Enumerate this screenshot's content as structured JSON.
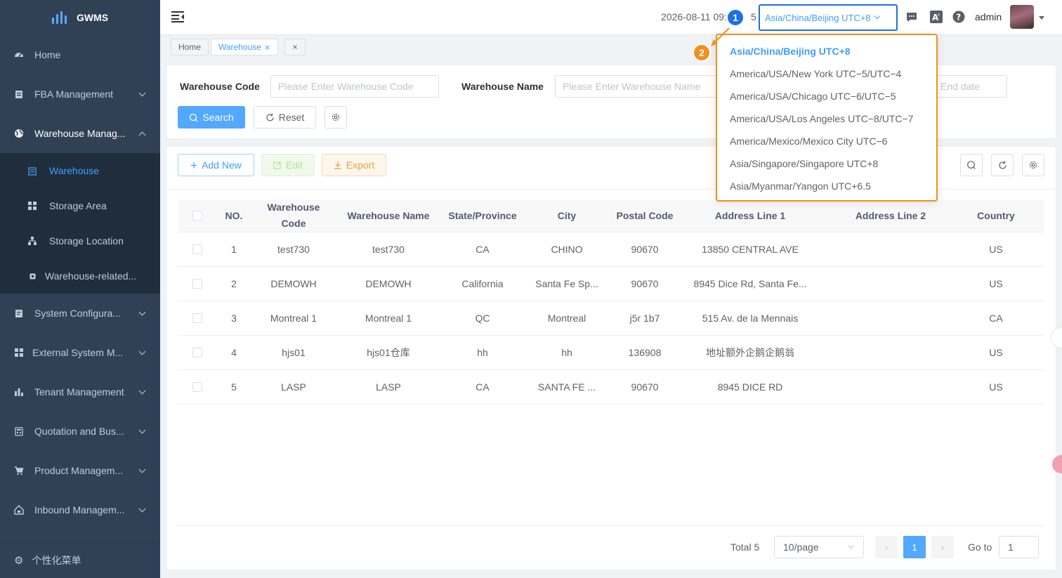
{
  "app": {
    "logo_text": "GWMS"
  },
  "sidebar": {
    "items": [
      {
        "label": "Home",
        "icon": "dashboard-icon"
      },
      {
        "label": "FBA Management",
        "icon": "clipboard-icon"
      },
      {
        "label": "Warehouse Manag...",
        "icon": "globe-icon"
      }
    ],
    "sub_items": [
      {
        "label": "Warehouse",
        "icon": "warehouse-icon",
        "active": true
      },
      {
        "label": "Storage Area",
        "icon": "grid-icon"
      },
      {
        "label": "Storage Location",
        "icon": "tree-icon"
      },
      {
        "label": "Warehouse-related...",
        "icon": "small-box-icon"
      }
    ],
    "items_after": [
      {
        "label": "System Configura...",
        "icon": "document-icon"
      },
      {
        "label": "External System M...",
        "icon": "apps-icon"
      },
      {
        "label": "Tenant Management",
        "icon": "bar-chart-icon"
      },
      {
        "label": "Quotation and Bus...",
        "icon": "calculator-icon"
      },
      {
        "label": "Product Managem...",
        "icon": "cart-icon"
      },
      {
        "label": "Inbound Managem...",
        "icon": "home-box-icon"
      }
    ],
    "bottom_label": "个性化菜单"
  },
  "header": {
    "datetime": "2026-08-11 09:",
    "datetime_tail": "5",
    "timezone": "Asia/China/Beijing UTC+8",
    "username": "admin"
  },
  "tags": {
    "home": "Home",
    "warehouse": "Warehouse",
    "close_all": "×"
  },
  "search": {
    "warehouse_code_label": "Warehouse Code",
    "warehouse_code_placeholder": "Please Enter Warehouse Code",
    "warehouse_name_label": "Warehouse Name",
    "warehouse_name_placeholder": "Please Enter Warehouse Name",
    "end_date_placeholder": "End date",
    "search_label": "Search",
    "reset_label": "Reset"
  },
  "toolbar": {
    "add_label": "Add New",
    "edit_label": "Edit",
    "export_label": "Export"
  },
  "table": {
    "headers": [
      "NO.",
      "Warehouse Code",
      "Warehouse Name",
      "State/Province",
      "City",
      "Postal Code",
      "Address Line 1",
      "Address Line 2",
      "Country"
    ],
    "rows": [
      [
        "1",
        "test730",
        "test730",
        "CA",
        "CHINO",
        "90670",
        "13850 CENTRAL AVE",
        "",
        "US"
      ],
      [
        "2",
        "DEMOWH",
        "DEMOWH",
        "California",
        "Santa Fe Sp...",
        "90670",
        "8945 Dice Rd, Santa Fe...",
        "",
        "US"
      ],
      [
        "3",
        "Montreal 1",
        "Montreal 1",
        "QC",
        "Montreal",
        "j5r 1b7",
        "515 Av. de la Mennais",
        "",
        "CA"
      ],
      [
        "4",
        "hjs01",
        "hjs01仓库",
        "hh",
        "hh",
        "136908",
        "地址额外企鹅企鹅翁",
        "",
        "US"
      ],
      [
        "5",
        "LASP",
        "LASP",
        "CA",
        "SANTA FE ...",
        "90670",
        "8945 DICE RD",
        "",
        "US"
      ]
    ]
  },
  "pagination": {
    "total": "Total 5",
    "page_size": "10/page",
    "current_page": "1",
    "goto_label": "Go to",
    "goto_value": "1"
  },
  "timezone_dropdown": {
    "options": [
      "Asia/China/Beijing UTC+8",
      "America/USA/New York UTC−5/UTC−4",
      "America/USA/Chicago UTC−6/UTC−5",
      "America/USA/Los Angeles UTC−8/UTC−7",
      "America/Mexico/Mexico City UTC−6",
      "Asia/Singapore/Singapore UTC+8",
      "Asia/Myanmar/Yangon UTC+6.5"
    ],
    "selected_index": 0
  },
  "annotations": {
    "badge_1": "1",
    "badge_2": "2"
  },
  "colors": {
    "accent": "#409eff",
    "annotation_blue": "#1e6fe8",
    "annotation_orange": "#f0901e",
    "sidebar_bg": "#304156"
  }
}
